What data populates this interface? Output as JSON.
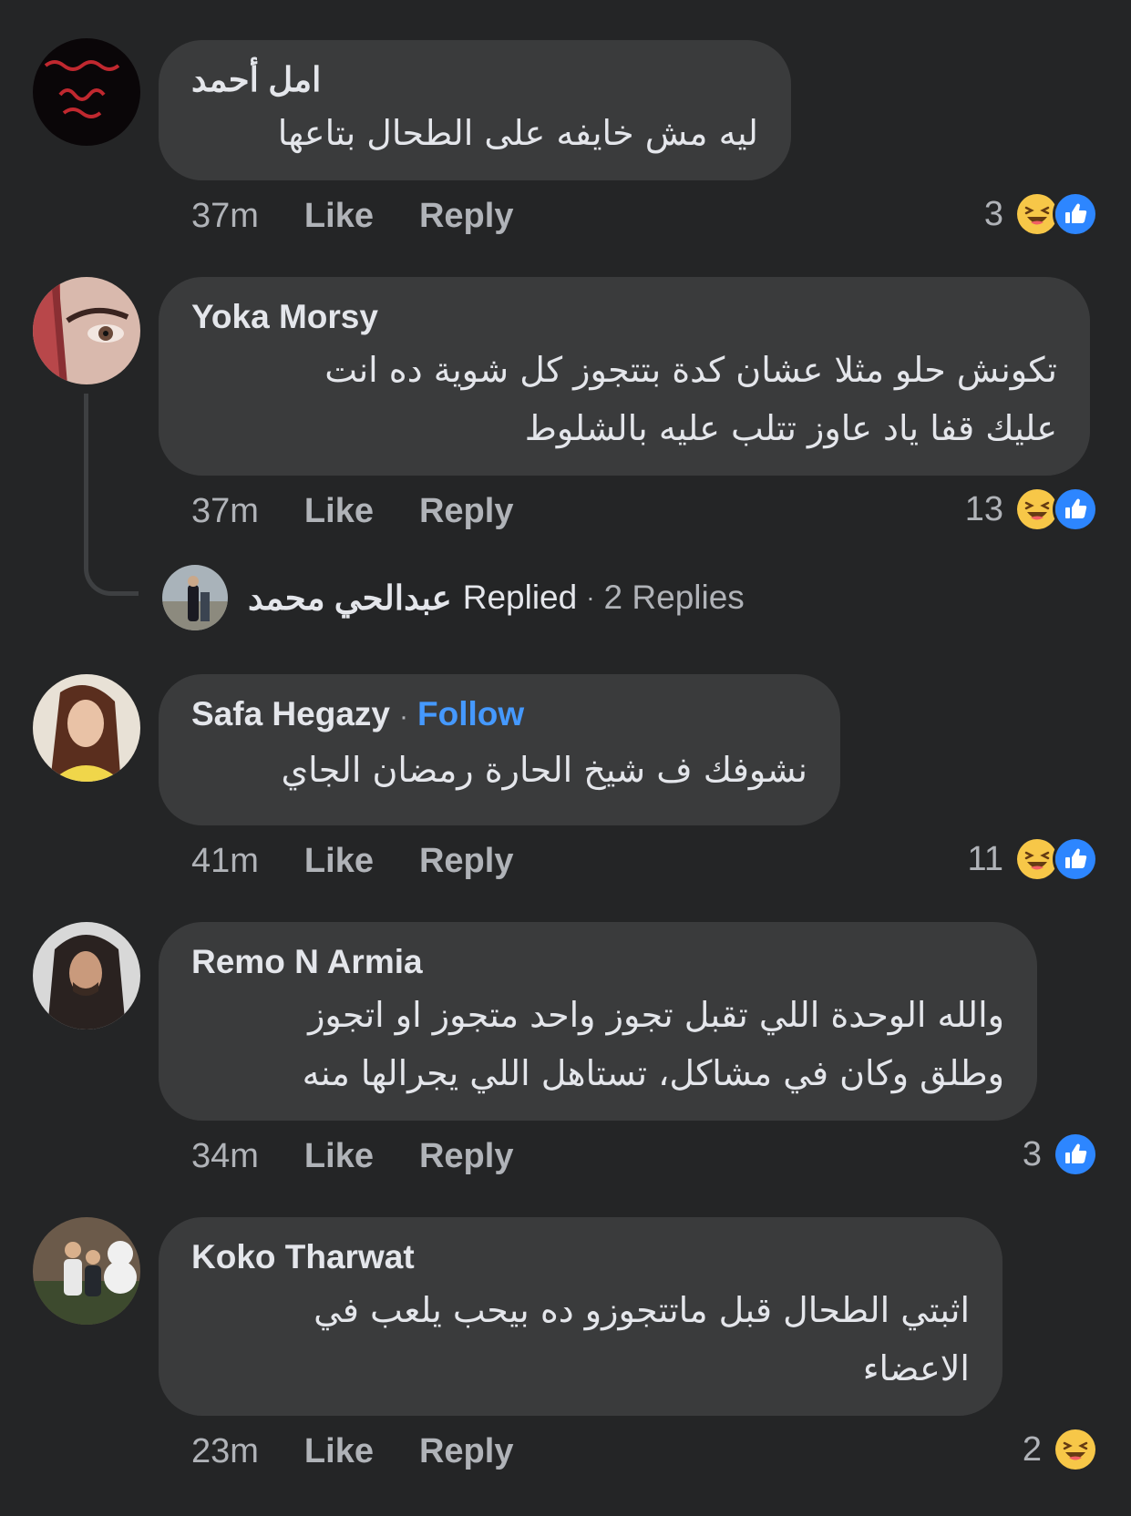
{
  "comments": [
    {
      "author": "امل أحمد",
      "avatar_text": "ست اظن وكنت اظن وخاااالب ظني",
      "lines": [
        "ليه مش خايفه على الطحال بتاعها"
      ],
      "time": "37m",
      "like_label": "Like",
      "reply_label": "Reply",
      "reaction_count": "3",
      "reactions": [
        "haha-icon",
        "like-icon"
      ]
    },
    {
      "author": "Yoka Morsy",
      "lines": [
        "تكونش حلو مثلا عشان كدة بتتجوز كل شوية ده انت",
        "عليك قفا ياد عاوز تتلب عليه بالشلوط"
      ],
      "time": "37m",
      "like_label": "Like",
      "reply_label": "Reply",
      "reaction_count": "13",
      "reactions": [
        "haha-icon",
        "like-icon"
      ],
      "replies_preview": {
        "name": "عبدالحي محمد",
        "replied_label": "Replied",
        "separator": "·",
        "count_label": "2 Replies"
      }
    },
    {
      "author": "Safa Hegazy",
      "follow_separator": "·",
      "follow_label": "Follow",
      "lines": [
        "نشوفك ف شيخ الحارة رمضان الجاي"
      ],
      "time": "41m",
      "like_label": "Like",
      "reply_label": "Reply",
      "reaction_count": "11",
      "reactions": [
        "haha-icon",
        "like-icon"
      ]
    },
    {
      "author": "Remo N Armia",
      "lines": [
        "والله الوحدة اللي تقبل تجوز واحد متجوز او اتجوز",
        "وطلق وكان في مشاكل، تستاهل اللي يجرالها منه"
      ],
      "time": "34m",
      "like_label": "Like",
      "reply_label": "Reply",
      "reaction_count": "3",
      "reactions": [
        "like-icon"
      ]
    },
    {
      "author": "Koko Tharwat",
      "lines": [
        "اثبتي الطحال قبل ماتتجوزو ده بيحب يلعب في",
        "الاعضاء"
      ],
      "time": "23m",
      "like_label": "Like",
      "reply_label": "Reply",
      "reaction_count": "2",
      "reactions": [
        "haha-icon"
      ]
    }
  ],
  "colors": {
    "background": "#242526",
    "bubble": "#3a3b3c",
    "text": "#e4e6eb",
    "secondary": "#b0b3b8",
    "accent": "#4599ff"
  }
}
